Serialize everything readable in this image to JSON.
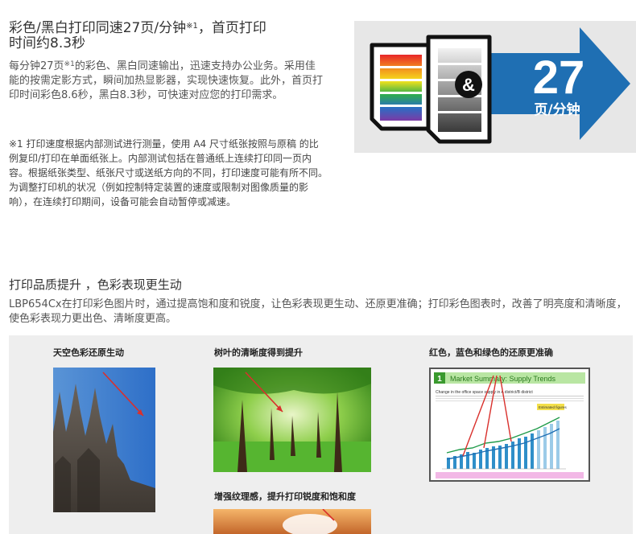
{
  "section1": {
    "title_line1_pre": "彩色/黑白打印同速27页/分钟",
    "title_note_mark": "※1",
    "title_line1_post": "，首页打印",
    "title_line2": "时间约8.3秒",
    "body_pre": "每分钟27页",
    "body_note_mark": "※1",
    "body_post": "的彩色、黑白同速输出，迅速支持办公业务。采用佳能的按需定影方式，瞬间加热显影器，实现快速恢复。此外，首页打印时间彩色8.6秒，黑白8.3秒，可快速对应您的打印需求。",
    "footnote": "※1 打印速度根据内部测试进行测量，使用 A4 尺寸纸张按照与原稿 的比例复印/打印在单面纸张上。内部测试包括在普通纸上连续打印同一页内容。根据纸张类型、纸张尺寸或送纸方向的不同，打印速度可能有所不同。为调整打印机的状况（例如控制特定装置的速度或限制对图像质量的影响），在连续打印期间，设备可能会自动暂停或减速。"
  },
  "speed_graphic": {
    "ampersand": "&",
    "speed_number": "27",
    "speed_unit": "页/分钟",
    "arrow_color": "#1f6fb3"
  },
  "section2": {
    "title": "打印品质提升 ，色彩表现更生动",
    "body": "LBP654Cx在打印彩色图片时，通过提高饱和度和锐度，让色彩表现更生动、还原更准确；打印彩色图表时，改善了明亮度和清晰度，使色彩表现力更出色、清晰度更高。"
  },
  "samples": {
    "caption_sky": "天空色彩还原生动",
    "caption_leaves": "树叶的清晰度得到提升",
    "caption_chart": "红色，蓝色和绿色的还原更准确",
    "caption_texture": "增强纹理感，提升打印锐度和饱和度",
    "chart_badge": "1",
    "chart_title": "Market Summary: Supply Trends",
    "chart_subtitle": "Change in the office space supply in A district/B district",
    "chart_legend_box": "Estimated figures",
    "arrow_color": "#d9302c"
  }
}
